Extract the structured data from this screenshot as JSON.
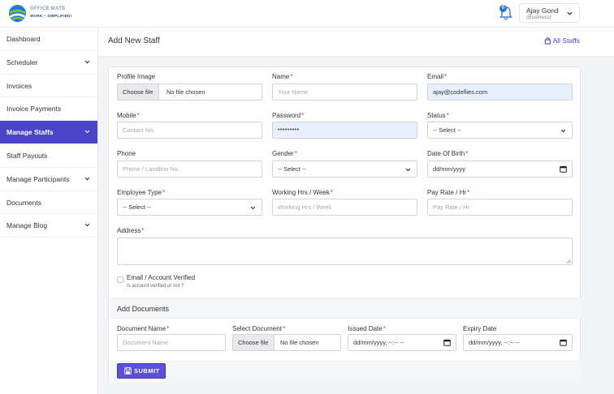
{
  "brand": {
    "title": "OFFICE MATE",
    "tagline": "WORK – SIMPLIFIED!"
  },
  "header": {
    "notification_count": "0",
    "user_name": "Ajay Gond",
    "user_role": "(Business)"
  },
  "sidebar": {
    "items": [
      {
        "label": "Dashboard",
        "has_submenu": false,
        "active": false
      },
      {
        "label": "Scheduler",
        "has_submenu": true,
        "active": false
      },
      {
        "label": "Invoices",
        "has_submenu": false,
        "active": false
      },
      {
        "label": "Invoice Payments",
        "has_submenu": false,
        "active": false
      },
      {
        "label": "Manage Staffs",
        "has_submenu": true,
        "active": true
      },
      {
        "label": "Staff Payouts",
        "has_submenu": false,
        "active": false
      },
      {
        "label": "Manage Participants",
        "has_submenu": true,
        "active": false
      },
      {
        "label": "Documents",
        "has_submenu": false,
        "active": false
      },
      {
        "label": "Manage Blog",
        "has_submenu": true,
        "active": false
      }
    ]
  },
  "page": {
    "title": "Add New Staff",
    "all_staffs_link": "All Staffs"
  },
  "form": {
    "profile_image": {
      "label": "Profile Image",
      "button": "Choose file",
      "status": "No file chosen"
    },
    "name": {
      "label": "Name",
      "required": "*",
      "placeholder": "Your Name"
    },
    "email": {
      "label": "Email",
      "required": "*",
      "value": "ajay@codeflies.com"
    },
    "mobile": {
      "label": "Mobile",
      "required": "*",
      "placeholder": "Contact No."
    },
    "password": {
      "label": "Password",
      "required": "*",
      "value": "•••••••••"
    },
    "status": {
      "label": "Status",
      "required": "*",
      "selected": "-- Select --"
    },
    "phone": {
      "label": "Phone",
      "placeholder": "Phone / Landline No."
    },
    "gender": {
      "label": "Gender",
      "required": "*",
      "selected": "-- Select --"
    },
    "dob": {
      "label": "Date Of Birth",
      "required": "*",
      "value": "dd/mm/yyyy"
    },
    "employee_type": {
      "label": "Employee Type",
      "required": "*",
      "selected": "-- Select --"
    },
    "working_hrs": {
      "label": "Working Hrs / Week",
      "required": "*",
      "placeholder": "Working Hrs / Week"
    },
    "pay_rate": {
      "label": "Pay Rate / Hr",
      "required": "*",
      "placeholder": "Pay Rate / Hr"
    },
    "address": {
      "label": "Address",
      "required": "*"
    },
    "verified": {
      "label": "Email / Account Verified",
      "hint": "Is account verified or not ?",
      "checked": false
    }
  },
  "documents": {
    "section_title": "Add Documents",
    "document_name": {
      "label": "Document Name",
      "required": "*",
      "placeholder": "Document Name"
    },
    "select_document": {
      "label": "Select Document",
      "required": "*",
      "button": "Choose file",
      "status": "No file chosen"
    },
    "issued_date": {
      "label": "Issued Date",
      "required": "*",
      "value": "dd/mm/yyyy, --:-- --"
    },
    "expiry_date": {
      "label": "Expiry Date",
      "value": "dd/mm/yyyy, --:-- --"
    }
  },
  "submit_label": "SUBMIT",
  "colors": {
    "accent": "#4b44c9",
    "required": "#d63b3b",
    "autofill": "#e8f0fe"
  }
}
